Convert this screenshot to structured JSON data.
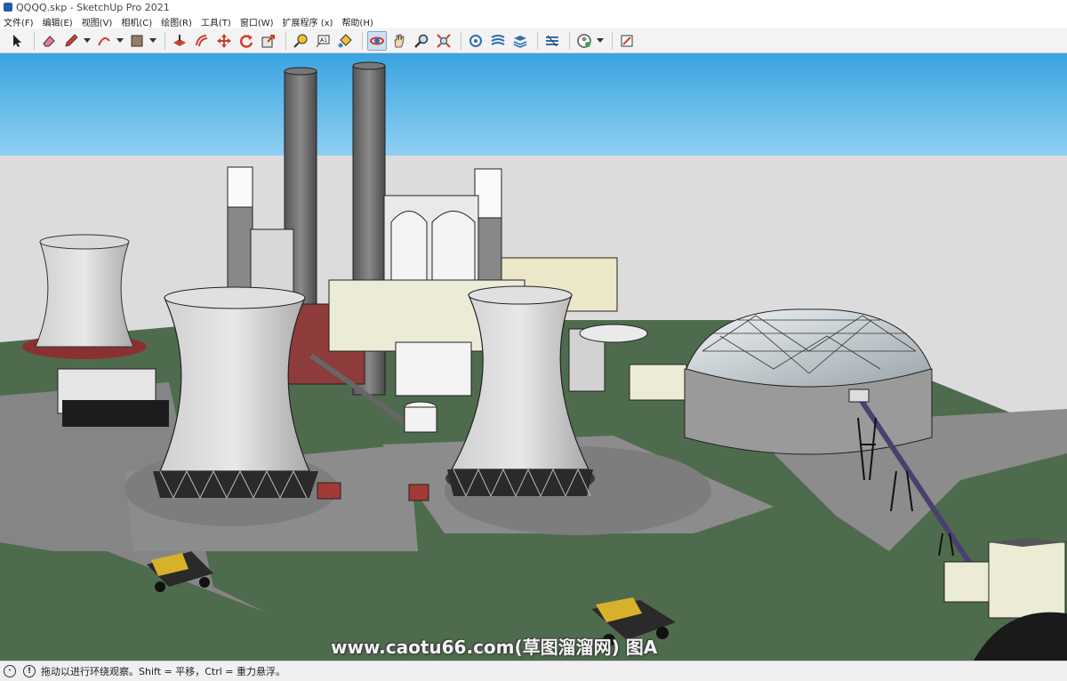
{
  "window": {
    "title": "QQQQ.skp - SketchUp Pro 2021"
  },
  "menu": {
    "items": [
      {
        "label": "文件(F)"
      },
      {
        "label": "编辑(E)"
      },
      {
        "label": "视图(V)"
      },
      {
        "label": "相机(C)"
      },
      {
        "label": "绘图(R)"
      },
      {
        "label": "工具(T)"
      },
      {
        "label": "窗口(W)"
      },
      {
        "label": "扩展程序 (x)"
      },
      {
        "label": "帮助(H)"
      }
    ]
  },
  "toolbar": {
    "tools": [
      "select-icon",
      "eraser-icon",
      "pencil-icon",
      "arc-icon",
      "rectangle-icon",
      "push-pull-icon",
      "offset-icon",
      "move-icon",
      "rotate-icon",
      "scale-icon",
      "tape-measure-icon",
      "text-icon",
      "paint-bucket-icon",
      "orbit-icon",
      "pan-icon",
      "zoom-icon",
      "zoom-extents-icon",
      "components-icon",
      "styles-icon",
      "layers-icon",
      "sandbox-icon",
      "warehouse-icon",
      "extension-icon"
    ],
    "active_tool": "orbit-icon"
  },
  "viewport": {
    "sky_color": "#4fb3e8",
    "ground_color": "#4f6b4d",
    "watermark": "www.caotu66.com(草图溜溜网) 图A"
  },
  "status": {
    "message": "拖动以进行环绕观察。Shift = 平移，Ctrl = 重力悬浮。"
  }
}
